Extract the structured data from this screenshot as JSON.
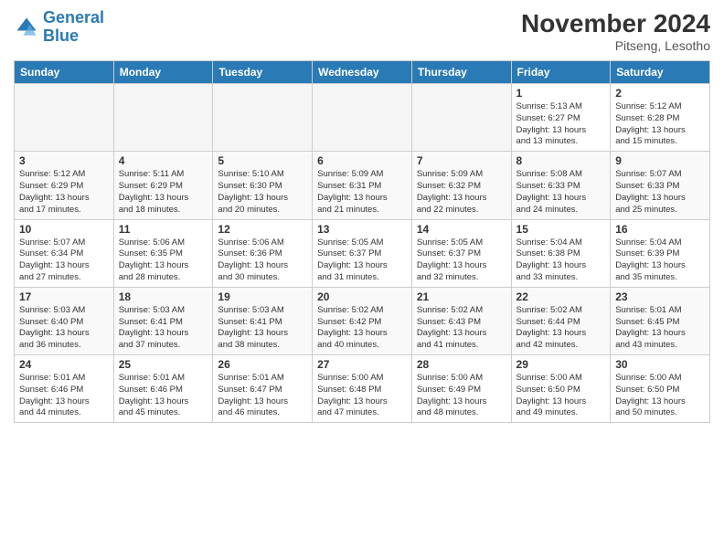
{
  "logo": {
    "line1": "General",
    "line2": "Blue"
  },
  "title": "November 2024",
  "subtitle": "Pitseng, Lesotho",
  "weekdays": [
    "Sunday",
    "Monday",
    "Tuesday",
    "Wednesday",
    "Thursday",
    "Friday",
    "Saturday"
  ],
  "weeks": [
    [
      {
        "day": "",
        "info": ""
      },
      {
        "day": "",
        "info": ""
      },
      {
        "day": "",
        "info": ""
      },
      {
        "day": "",
        "info": ""
      },
      {
        "day": "",
        "info": ""
      },
      {
        "day": "1",
        "info": "Sunrise: 5:13 AM\nSunset: 6:27 PM\nDaylight: 13 hours\nand 13 minutes."
      },
      {
        "day": "2",
        "info": "Sunrise: 5:12 AM\nSunset: 6:28 PM\nDaylight: 13 hours\nand 15 minutes."
      }
    ],
    [
      {
        "day": "3",
        "info": "Sunrise: 5:12 AM\nSunset: 6:29 PM\nDaylight: 13 hours\nand 17 minutes."
      },
      {
        "day": "4",
        "info": "Sunrise: 5:11 AM\nSunset: 6:29 PM\nDaylight: 13 hours\nand 18 minutes."
      },
      {
        "day": "5",
        "info": "Sunrise: 5:10 AM\nSunset: 6:30 PM\nDaylight: 13 hours\nand 20 minutes."
      },
      {
        "day": "6",
        "info": "Sunrise: 5:09 AM\nSunset: 6:31 PM\nDaylight: 13 hours\nand 21 minutes."
      },
      {
        "day": "7",
        "info": "Sunrise: 5:09 AM\nSunset: 6:32 PM\nDaylight: 13 hours\nand 22 minutes."
      },
      {
        "day": "8",
        "info": "Sunrise: 5:08 AM\nSunset: 6:33 PM\nDaylight: 13 hours\nand 24 minutes."
      },
      {
        "day": "9",
        "info": "Sunrise: 5:07 AM\nSunset: 6:33 PM\nDaylight: 13 hours\nand 25 minutes."
      }
    ],
    [
      {
        "day": "10",
        "info": "Sunrise: 5:07 AM\nSunset: 6:34 PM\nDaylight: 13 hours\nand 27 minutes."
      },
      {
        "day": "11",
        "info": "Sunrise: 5:06 AM\nSunset: 6:35 PM\nDaylight: 13 hours\nand 28 minutes."
      },
      {
        "day": "12",
        "info": "Sunrise: 5:06 AM\nSunset: 6:36 PM\nDaylight: 13 hours\nand 30 minutes."
      },
      {
        "day": "13",
        "info": "Sunrise: 5:05 AM\nSunset: 6:37 PM\nDaylight: 13 hours\nand 31 minutes."
      },
      {
        "day": "14",
        "info": "Sunrise: 5:05 AM\nSunset: 6:37 PM\nDaylight: 13 hours\nand 32 minutes."
      },
      {
        "day": "15",
        "info": "Sunrise: 5:04 AM\nSunset: 6:38 PM\nDaylight: 13 hours\nand 33 minutes."
      },
      {
        "day": "16",
        "info": "Sunrise: 5:04 AM\nSunset: 6:39 PM\nDaylight: 13 hours\nand 35 minutes."
      }
    ],
    [
      {
        "day": "17",
        "info": "Sunrise: 5:03 AM\nSunset: 6:40 PM\nDaylight: 13 hours\nand 36 minutes."
      },
      {
        "day": "18",
        "info": "Sunrise: 5:03 AM\nSunset: 6:41 PM\nDaylight: 13 hours\nand 37 minutes."
      },
      {
        "day": "19",
        "info": "Sunrise: 5:03 AM\nSunset: 6:41 PM\nDaylight: 13 hours\nand 38 minutes."
      },
      {
        "day": "20",
        "info": "Sunrise: 5:02 AM\nSunset: 6:42 PM\nDaylight: 13 hours\nand 40 minutes."
      },
      {
        "day": "21",
        "info": "Sunrise: 5:02 AM\nSunset: 6:43 PM\nDaylight: 13 hours\nand 41 minutes."
      },
      {
        "day": "22",
        "info": "Sunrise: 5:02 AM\nSunset: 6:44 PM\nDaylight: 13 hours\nand 42 minutes."
      },
      {
        "day": "23",
        "info": "Sunrise: 5:01 AM\nSunset: 6:45 PM\nDaylight: 13 hours\nand 43 minutes."
      }
    ],
    [
      {
        "day": "24",
        "info": "Sunrise: 5:01 AM\nSunset: 6:46 PM\nDaylight: 13 hours\nand 44 minutes."
      },
      {
        "day": "25",
        "info": "Sunrise: 5:01 AM\nSunset: 6:46 PM\nDaylight: 13 hours\nand 45 minutes."
      },
      {
        "day": "26",
        "info": "Sunrise: 5:01 AM\nSunset: 6:47 PM\nDaylight: 13 hours\nand 46 minutes."
      },
      {
        "day": "27",
        "info": "Sunrise: 5:00 AM\nSunset: 6:48 PM\nDaylight: 13 hours\nand 47 minutes."
      },
      {
        "day": "28",
        "info": "Sunrise: 5:00 AM\nSunset: 6:49 PM\nDaylight: 13 hours\nand 48 minutes."
      },
      {
        "day": "29",
        "info": "Sunrise: 5:00 AM\nSunset: 6:50 PM\nDaylight: 13 hours\nand 49 minutes."
      },
      {
        "day": "30",
        "info": "Sunrise: 5:00 AM\nSunset: 6:50 PM\nDaylight: 13 hours\nand 50 minutes."
      }
    ]
  ]
}
